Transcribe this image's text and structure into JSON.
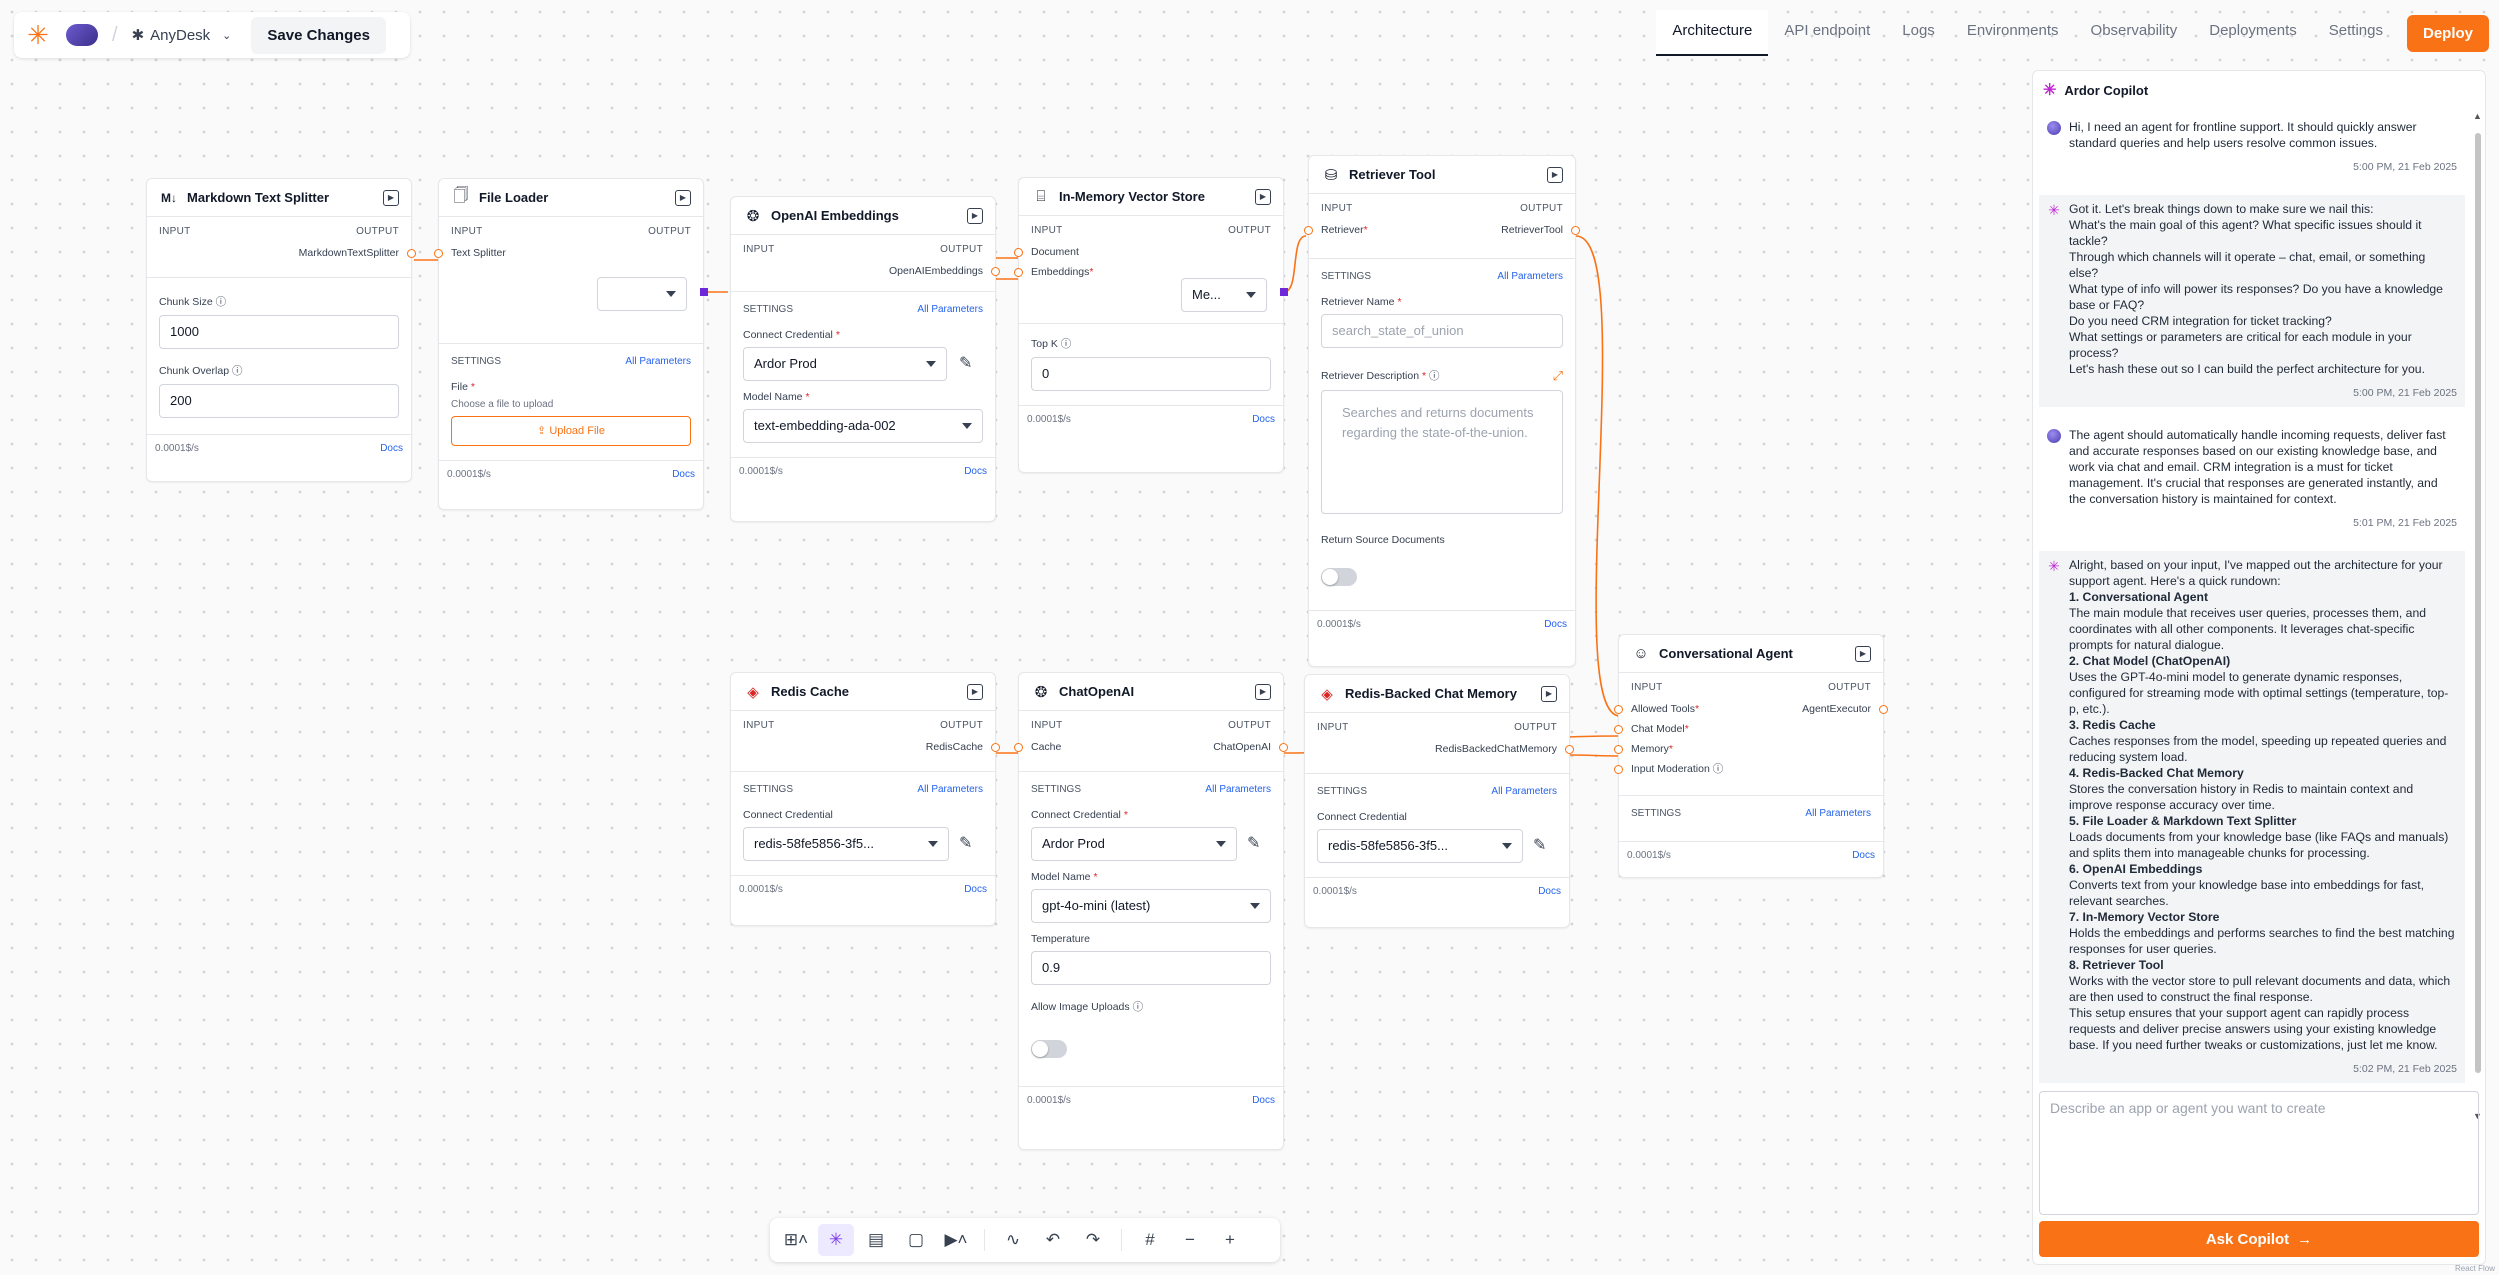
{
  "header": {
    "app_name": "AnyDesk",
    "save_label": "Save Changes"
  },
  "nav": {
    "tabs": [
      "Architecture",
      "API endpoint",
      "Logs",
      "Environments",
      "Observability",
      "Deployments",
      "Settings"
    ],
    "deploy_label": "Deploy",
    "active_tab": "Architecture"
  },
  "nodes": {
    "markdown": {
      "title": "Markdown Text Splitter",
      "input": "INPUT",
      "output": "OUTPUT",
      "out_port": "MarkdownTextSplitter",
      "chunk_size_label": "Chunk Size",
      "chunk_size": "1000",
      "chunk_overlap_label": "Chunk Overlap",
      "chunk_overlap": "200",
      "cost": "0.0001$/s",
      "docs": "Docs"
    },
    "fileloader": {
      "title": "File Loader",
      "input": "INPUT",
      "output": "OUTPUT",
      "in_port": "Text Splitter",
      "settings": "SETTINGS",
      "all_params": "All Parameters",
      "file_label": "File",
      "file_hint": "Choose a file to upload",
      "upload": "Upload File",
      "cost": "0.0001$/s",
      "docs": "Docs"
    },
    "embeddings": {
      "title": "OpenAI Embeddings",
      "input": "INPUT",
      "output": "OUTPUT",
      "out_port": "OpenAIEmbeddings",
      "settings": "SETTINGS",
      "all_params": "All Parameters",
      "cred_label": "Connect Credential",
      "cred": "Ardor Prod",
      "model_label": "Model Name",
      "model": "text-embedding-ada-002",
      "cost": "0.0001$/s",
      "docs": "Docs"
    },
    "vectorstore": {
      "title": "In-Memory Vector Store",
      "input": "INPUT",
      "output": "OUTPUT",
      "in_doc": "Document",
      "in_emb": "Embeddings",
      "out_sel": "Me...",
      "topk_label": "Top K",
      "topk": "0",
      "cost": "0.0001$/s",
      "docs": "Docs"
    },
    "retriever": {
      "title": "Retriever Tool",
      "input": "INPUT",
      "output": "OUTPUT",
      "in_port": "Retriever",
      "out_port": "RetrieverTool",
      "settings": "SETTINGS",
      "all_params": "All Parameters",
      "name_label": "Retriever Name",
      "name_ph": "search_state_of_union",
      "desc_label": "Retriever Description",
      "desc_ph": "Searches and returns documents regarding the state-of-the-union.",
      "return_label": "Return Source Documents",
      "cost": "0.0001$/s",
      "docs": "Docs"
    },
    "rediscache": {
      "title": "Redis Cache",
      "input": "INPUT",
      "output": "OUTPUT",
      "out_port": "RedisCache",
      "settings": "SETTINGS",
      "all_params": "All Parameters",
      "cred_label": "Connect Credential",
      "cred": "redis-58fe5856-3f5...",
      "cost": "0.0001$/s",
      "docs": "Docs"
    },
    "chatopenai": {
      "title": "ChatOpenAI",
      "input": "INPUT",
      "output": "OUTPUT",
      "in_port": "Cache",
      "out_port": "ChatOpenAI",
      "settings": "SETTINGS",
      "all_params": "All Parameters",
      "cred_label": "Connect Credential",
      "cred": "Ardor Prod",
      "model_label": "Model Name",
      "model": "gpt-4o-mini (latest)",
      "temp_label": "Temperature",
      "temp": "0.9",
      "img_label": "Allow Image Uploads",
      "cost": "0.0001$/s",
      "docs": "Docs"
    },
    "redismemory": {
      "title": "Redis-Backed Chat Memory",
      "input": "INPUT",
      "output": "OUTPUT",
      "out_port": "RedisBackedChatMemory",
      "settings": "SETTINGS",
      "all_params": "All Parameters",
      "cred_label": "Connect Credential",
      "cred": "redis-58fe5856-3f5...",
      "cost": "0.0001$/s",
      "docs": "Docs"
    },
    "agent": {
      "title": "Conversational Agent",
      "input": "INPUT",
      "output": "OUTPUT",
      "in_tools": "Allowed Tools",
      "in_model": "Chat Model",
      "in_memory": "Memory",
      "in_mod": "Input Moderation",
      "out_port": "AgentExecutor",
      "settings": "SETTINGS",
      "all_params": "All Parameters",
      "cost": "0.0001$/s",
      "docs": "Docs"
    }
  },
  "copilot": {
    "title": "Ardor Copilot",
    "m1": {
      "text": "Hi, I need an agent for frontline support. It should quickly answer standard queries and help users resolve common issues.",
      "time": "5:00 PM, 21 Feb 2025"
    },
    "m2": {
      "lines": [
        "Got it. Let's break things down to make sure we nail this:",
        "What's the main goal of this agent? What specific issues should it tackle?",
        "Through which channels will it operate – chat, email, or something else?",
        "What type of info will power its responses? Do you have a knowledge base or FAQ?",
        "Do you need CRM integration for ticket tracking?",
        "What settings or parameters are critical for each module in your process?",
        "Let's hash these out so I can build the perfect architecture for you."
      ],
      "time": "5:00 PM, 21 Feb 2025"
    },
    "m3": {
      "text": "The agent should automatically handle incoming requests, deliver fast and accurate responses based on our existing knowledge base, and work via chat and email. CRM integration is a must for ticket management. It's crucial that responses are generated instantly, and the conversation history is maintained for context.",
      "time": "5:01 PM, 21 Feb 2025"
    },
    "m4": {
      "intro": "Alright, based on your input, I've mapped out the architecture for your support agent. Here's a quick rundown:",
      "h1": "1. Conversational Agent",
      "p1": "The main module that receives user queries, processes them, and coordinates with all other components. It leverages chat-specific prompts for natural dialogue.",
      "h2": "2. Chat Model (ChatOpenAI)",
      "p2": "Uses the GPT-4o-mini model to generate dynamic responses, configured for streaming mode with optimal settings (temperature, top-p, etc.).",
      "h3": "3. Redis Cache",
      "p3": "Caches responses from the model, speeding up repeated queries and reducing system load.",
      "h4": "4. Redis-Backed Chat Memory",
      "p4": "Stores the conversation history in Redis to maintain context and improve response accuracy over time.",
      "h5": "5. File Loader & Markdown Text Splitter",
      "p5": "Loads documents from your knowledge base (like FAQs and manuals) and splits them into manageable chunks for processing.",
      "h6": "6. OpenAI Embeddings",
      "p6": "Converts text from your knowledge base into embeddings for fast, relevant searches.",
      "h7": "7. In-Memory Vector Store",
      "p7": "Holds the embeddings and performs searches to find the best matching responses for user queries.",
      "h8": "8. Retriever Tool",
      "p8": "Works with the vector store to pull relevant documents and data, which are then used to construct the final response.",
      "outro": "This setup ensures that your support agent can rapidly process requests and deliver precise answers using your existing knowledge base. If you need further tweaks or customizations, just let me know.",
      "time": "5:02 PM, 21 Feb 2025"
    },
    "input_ph": "Describe an app or agent you want to create",
    "ask": "Ask Copilot"
  },
  "footer": {
    "react_flow": "React Flow"
  }
}
